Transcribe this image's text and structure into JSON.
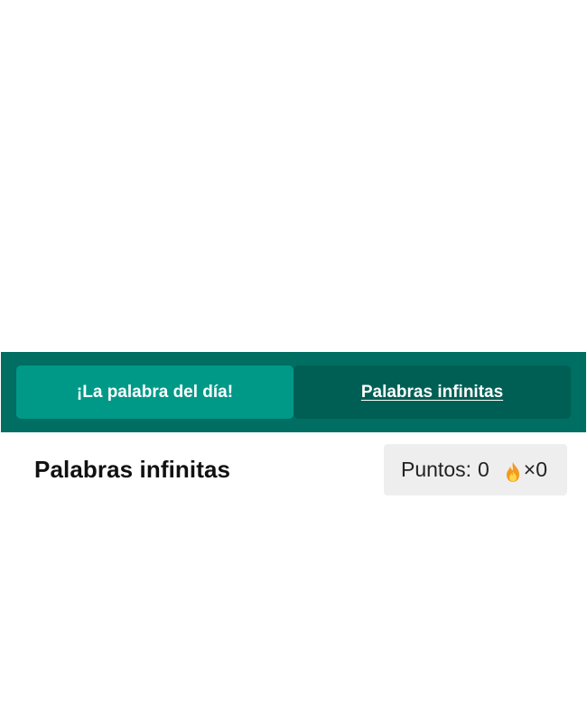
{
  "modes": {
    "daily_label": "¡La palabra del día!",
    "infinite_label": "Palabras infinitas",
    "active": "infinite"
  },
  "game": {
    "title": "Palabras infinitas",
    "score_label": "Puntos:",
    "score_value": "0",
    "streak_icon": "fire-icon",
    "streak_count": "×0"
  },
  "colors": {
    "mode_bar": "#006e62",
    "tab_daily": "#009987",
    "tab_active": "#005f54",
    "score_box": "#eeeeee"
  }
}
